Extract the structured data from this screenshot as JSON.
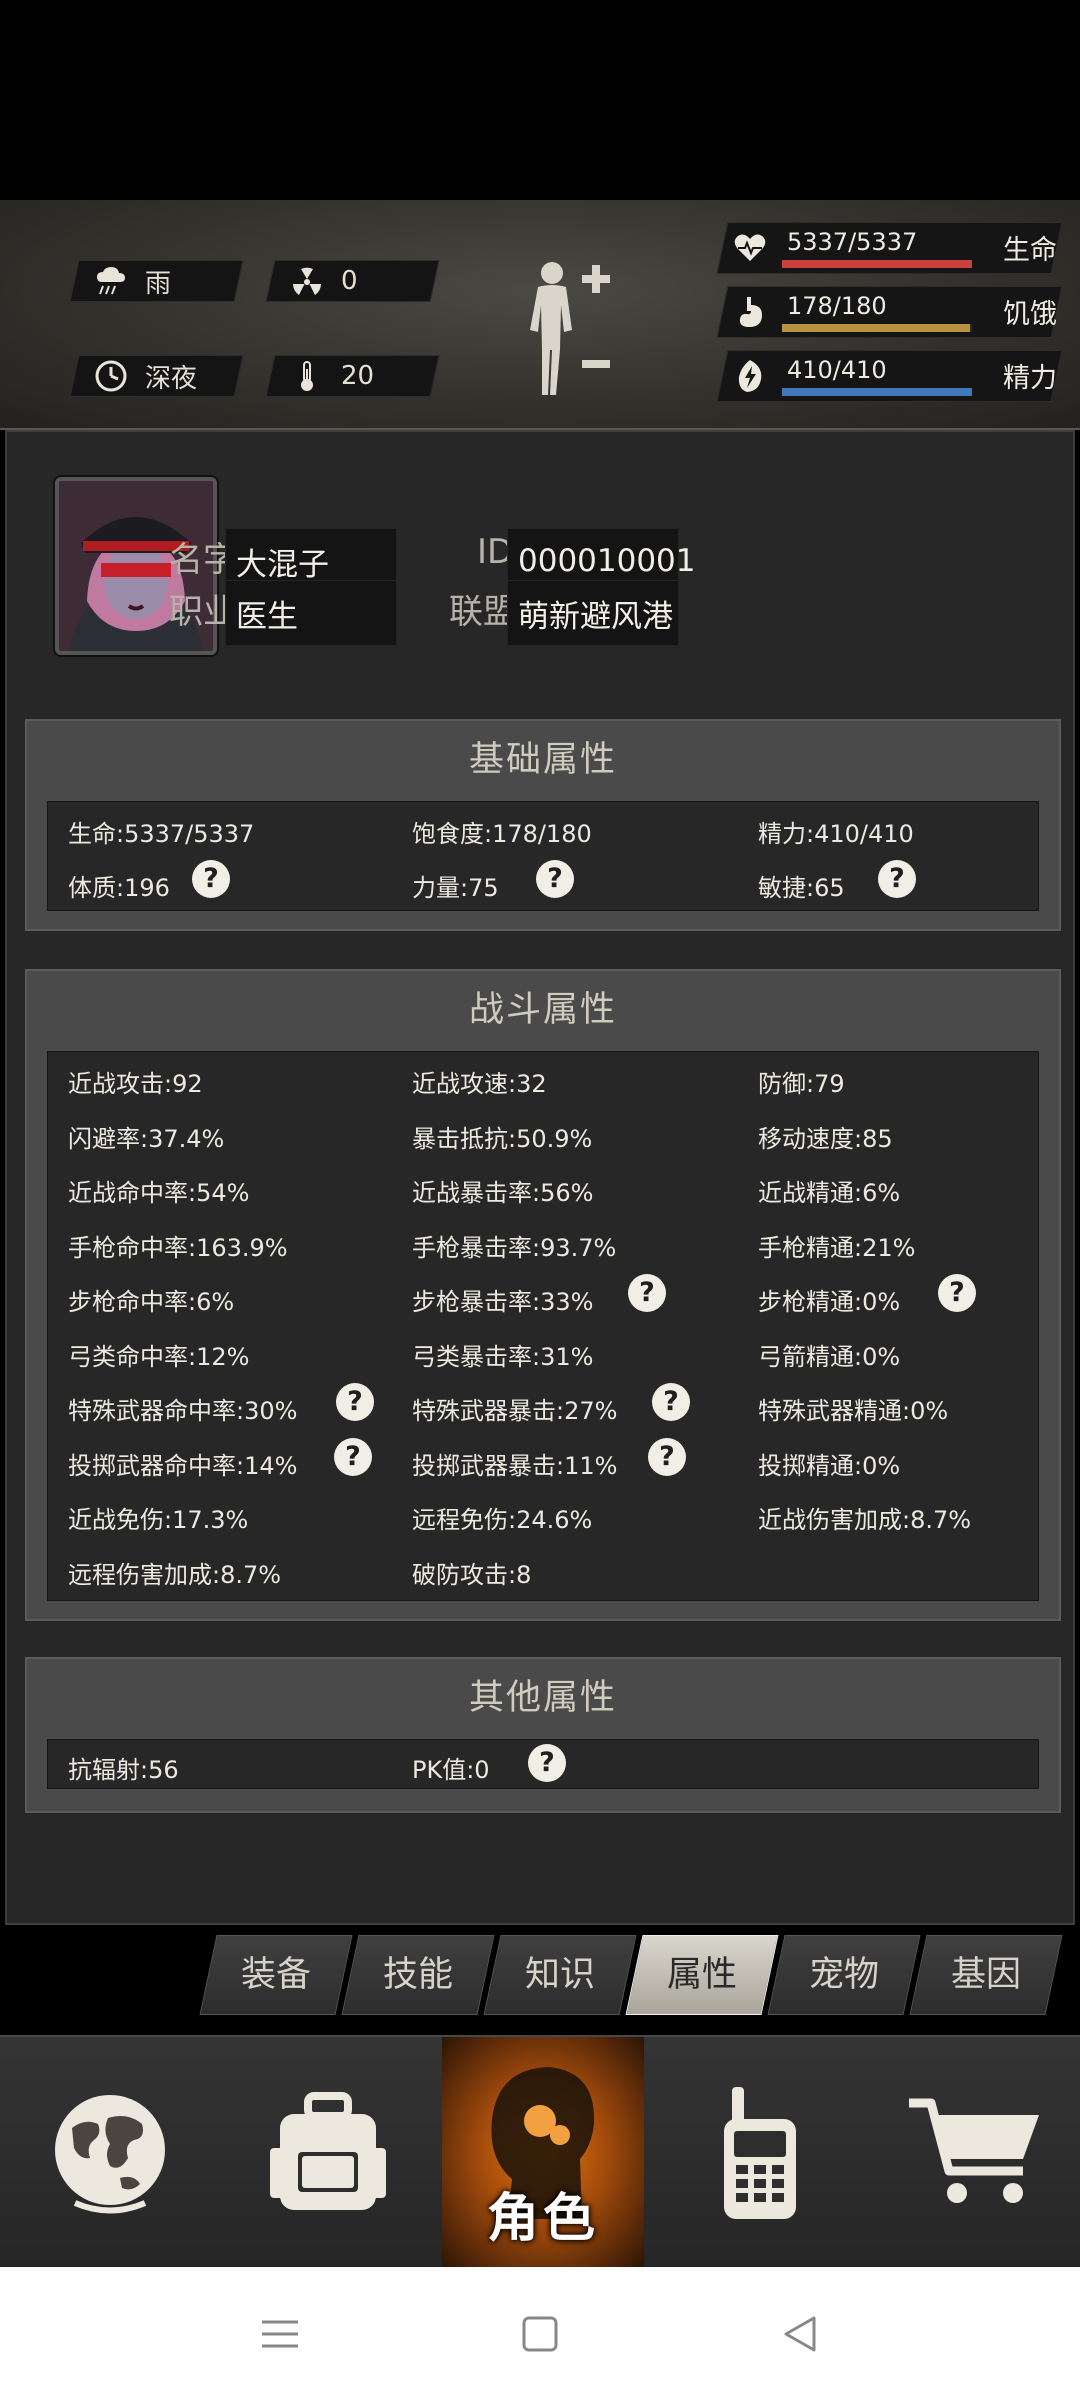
{
  "environment": {
    "weather": {
      "icon": "rain-cloud-icon",
      "label": "雨"
    },
    "radiation": {
      "icon": "radiation-icon",
      "value": "0"
    },
    "time": {
      "icon": "clock-icon",
      "label": "深夜"
    },
    "temperature": {
      "icon": "thermometer-icon",
      "value": "20"
    }
  },
  "vitals": [
    {
      "icon": "heart-pulse-icon",
      "value": "5337/5337",
      "label": "生命",
      "fraction": 1.0,
      "color": "#c8403a"
    },
    {
      "icon": "stomach-icon",
      "value": "178/180",
      "label": "饥饿",
      "fraction": 0.989,
      "color": "#b8923f"
    },
    {
      "icon": "energy-bolt-icon",
      "value": "410/410",
      "label": "精力",
      "fraction": 1.0,
      "color": "#3f79b8"
    }
  ],
  "profile": {
    "name_label": "名字:",
    "name": "大混子",
    "id_label": "ID:",
    "id": "000010001",
    "job_label": "职业:",
    "job": "医生",
    "alliance_label": "联盟:",
    "alliance": "萌新避风港"
  },
  "basic": {
    "title": "基础属性",
    "stats": [
      "生命:5337/5337",
      "饱食度:178/180",
      "精力:410/410",
      "体质:196",
      "力量:75",
      "敏捷:65"
    ]
  },
  "combat": {
    "title": "战斗属性",
    "stats": [
      "近战攻击:92",
      "近战攻速:32",
      "防御:79",
      "闪避率:37.4%",
      "暴击抵抗:50.9%",
      "移动速度:85",
      "近战命中率:54%",
      "近战暴击率:56%",
      "近战精通:6%",
      "手枪命中率:163.9%",
      "手枪暴击率:93.7%",
      "手枪精通:21%",
      "步枪命中率:6%",
      "步枪暴击率:33%",
      "步枪精通:0%",
      "弓类命中率:12%",
      "弓类暴击率:31%",
      "弓箭精通:0%",
      "特殊武器命中率:30%",
      "特殊武器暴击:27%",
      "特殊武器精通:0%",
      "投掷武器命中率:14%",
      "投掷武器暴击:11%",
      "投掷精通:0%",
      "近战免伤:17.3%",
      "远程免伤:24.6%",
      "近战伤害加成:8.7%",
      "远程伤害加成:8.7%",
      "破防攻击:8"
    ]
  },
  "other": {
    "title": "其他属性",
    "stats": [
      "抗辐射:56",
      "PK值:0"
    ]
  },
  "help_glyph": "?",
  "tabs": [
    "装备",
    "技能",
    "知识",
    "属性",
    "宠物",
    "基因"
  ],
  "active_tab": "属性",
  "bottom_nav": {
    "world_icon": "globe-icon",
    "bag_icon": "backpack-icon",
    "role_label": "角色",
    "radio_icon": "walkie-talkie-icon",
    "shop_icon": "shopping-cart-icon"
  },
  "system_nav": [
    "menu-icon",
    "home-square-icon",
    "back-triangle-icon"
  ]
}
